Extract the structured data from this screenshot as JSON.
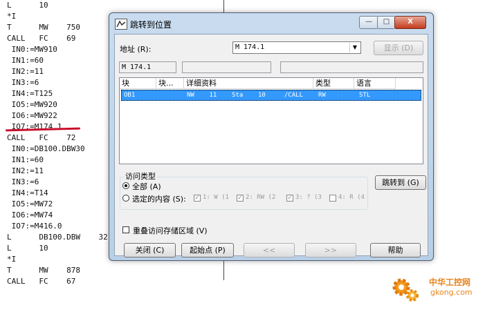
{
  "code_listing": {
    "lines": [
      "L      10",
      "*I",
      "T      MW    750",
      "CALL   FC    69",
      " IN0:=MW910",
      " IN1:=60",
      " IN2:=11",
      " IN3:=6",
      " IN4:=T125",
      " IO5:=MW920",
      " IO6:=MW922",
      " IO7:=M174.1",
      "CALL   FC    72",
      " IN0:=DB100.DBW30",
      " IN1:=60",
      " IN2:=11",
      " IN3:=6",
      " IN4:=T14",
      " IO5:=MW72",
      " IO6:=MW74",
      " IO7:=M416.0",
      "L      DB100.DBW    32",
      "L      10",
      "*I",
      "T      MW    878",
      "CALL   FC    67"
    ]
  },
  "dialog": {
    "title": "跳转到位置",
    "window_buttons": {
      "minimize": "—",
      "maximize": "□",
      "close": "X"
    },
    "address_label": "地址 (R):",
    "address_value": "M      174.1",
    "display_button": "显示 (D)",
    "address_field_value": "M      174.1",
    "list": {
      "columns": [
        "块",
        "块...",
        "详细资料",
        "类型",
        "语言"
      ],
      "rows": [
        {
          "block": "OB1",
          "details": "NW    11    Sta    10     /CALL",
          "type": "RW",
          "language": "STL"
        }
      ]
    },
    "access_type": {
      "title": "访问类型",
      "option_all": "全部 (A)",
      "option_selected": "选定的内容 (S):",
      "selected_option": "all",
      "filters": [
        {
          "label": "1: W  (1",
          "checked": true
        },
        {
          "label": "2: RW  (2",
          "checked": true
        },
        {
          "label": "3: ?  (3",
          "checked": true
        },
        {
          "label": "4: R  (4",
          "checked": false
        }
      ]
    },
    "goto_button": "跳转到 (G)",
    "overlap_checkbox": {
      "label": "重叠访问存储区域 (V)",
      "checked": false
    },
    "footer_buttons": {
      "close": "关闭 (C)",
      "origin": "起始点 (P)",
      "prev": "<<",
      "next": ">>",
      "help": "帮助"
    }
  },
  "watermark": {
    "text_top": "中华工控网",
    "text_bottom": "gkong.com"
  }
}
